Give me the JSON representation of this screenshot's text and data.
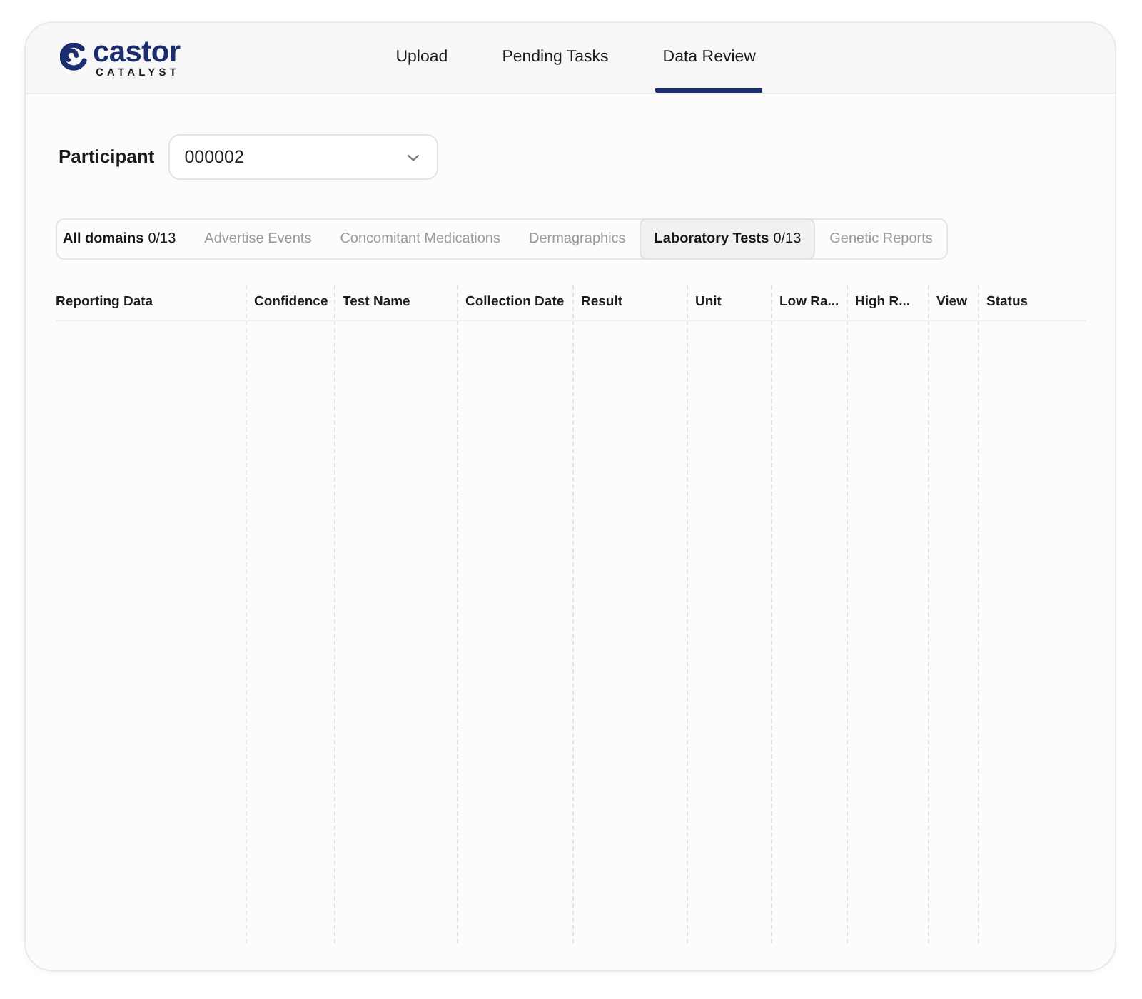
{
  "logo": {
    "name": "castor",
    "tagline": "CATALYST"
  },
  "nav": [
    {
      "label": "Upload",
      "selected": false
    },
    {
      "label": "Pending Tasks",
      "selected": false
    },
    {
      "label": "Data Review",
      "selected": true
    }
  ],
  "participant": {
    "label": "Participant",
    "value": "000002"
  },
  "domain_tabs": [
    {
      "label": "All domains",
      "count": "0/13",
      "selected": false,
      "disabled": false
    },
    {
      "label": "Advertise Events",
      "selected": false,
      "disabled": true
    },
    {
      "label": "Concomitant Medications",
      "selected": false,
      "disabled": true
    },
    {
      "label": "Dermagraphics",
      "selected": false,
      "disabled": true
    },
    {
      "label": "Laboratory Tests",
      "count": "0/13",
      "selected": true,
      "disabled": false
    },
    {
      "label": "Genetic Reports",
      "selected": false,
      "disabled": true
    }
  ],
  "table": {
    "columns": [
      "Reporting Data",
      "Confidence",
      "Test Name",
      "Collection Date",
      "Result",
      "Unit",
      "Low Ra...",
      "High R...",
      "View",
      "Status"
    ]
  }
}
